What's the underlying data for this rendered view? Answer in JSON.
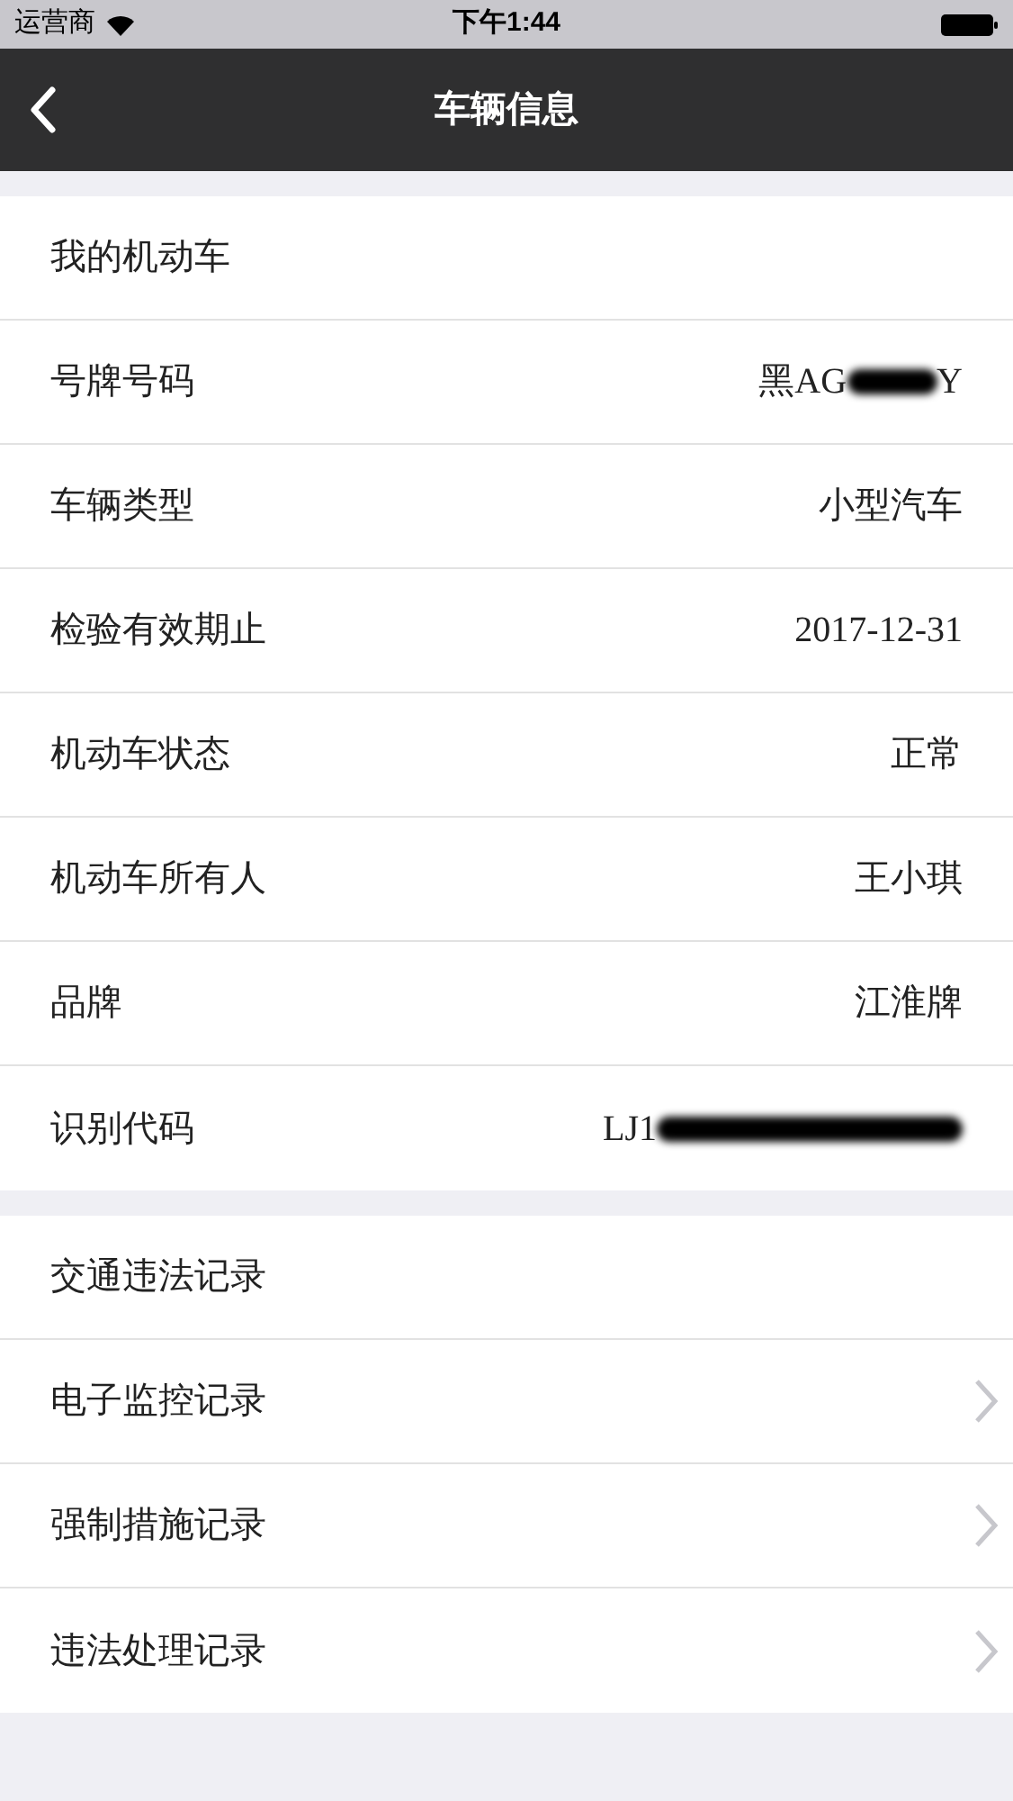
{
  "status_bar": {
    "carrier": "运营商",
    "time": "下午1:44"
  },
  "nav": {
    "title": "车辆信息"
  },
  "groups": [
    {
      "rows": [
        {
          "kind": "header",
          "label": "我的机动车"
        },
        {
          "kind": "value",
          "label": "号牌号码",
          "parts": [
            {
              "text": "黑AG"
            },
            {
              "redacted": true
            },
            {
              "text": "Y"
            }
          ]
        },
        {
          "kind": "value",
          "label": "车辆类型",
          "parts": [
            {
              "text": "小型汽车"
            }
          ]
        },
        {
          "kind": "value",
          "label": "检验有效期止",
          "parts": [
            {
              "text": "2017-12-31"
            }
          ]
        },
        {
          "kind": "value",
          "label": "机动车状态",
          "parts": [
            {
              "text": "正常"
            }
          ]
        },
        {
          "kind": "value",
          "label": "机动车所有人",
          "parts": [
            {
              "text": "王小琪"
            }
          ]
        },
        {
          "kind": "value",
          "label": "品牌",
          "parts": [
            {
              "text": "江淮牌"
            }
          ]
        },
        {
          "kind": "value",
          "label": "识别代码",
          "parts": [
            {
              "text": "LJ1"
            },
            {
              "redacted": true,
              "wide": true
            }
          ]
        }
      ]
    },
    {
      "rows": [
        {
          "kind": "header",
          "label": "交通违法记录"
        },
        {
          "kind": "link",
          "label": "电子监控记录"
        },
        {
          "kind": "link",
          "label": "强制措施记录"
        },
        {
          "kind": "link",
          "label": "违法处理记录"
        }
      ]
    }
  ]
}
